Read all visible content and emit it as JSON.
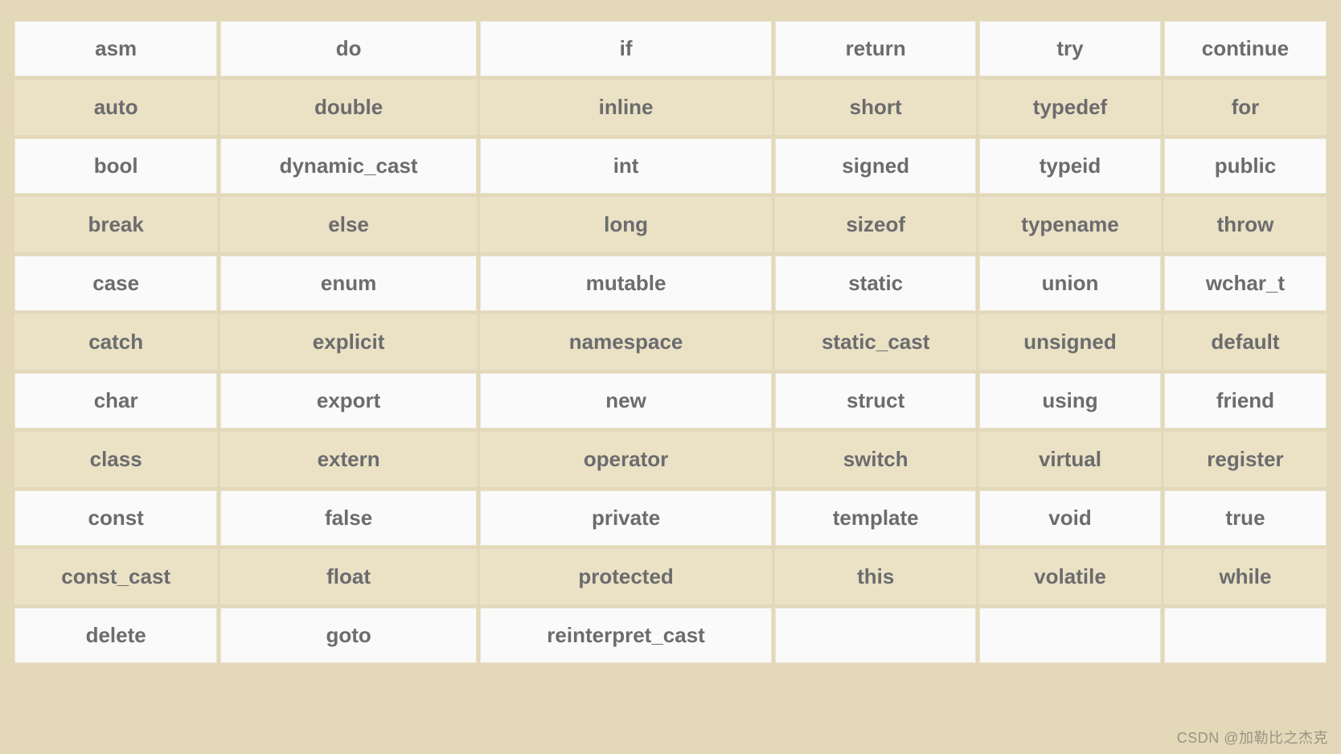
{
  "table": {
    "rows": [
      [
        "asm",
        "do",
        "if",
        "return",
        "try",
        "continue"
      ],
      [
        "auto",
        "double",
        "inline",
        "short",
        "typedef",
        "for"
      ],
      [
        "bool",
        "dynamic_cast",
        "int",
        "signed",
        "typeid",
        "public"
      ],
      [
        "break",
        "else",
        "long",
        "sizeof",
        "typename",
        "throw"
      ],
      [
        "case",
        "enum",
        "mutable",
        "static",
        "union",
        "wchar_t"
      ],
      [
        "catch",
        "explicit",
        "namespace",
        "static_cast",
        "unsigned",
        "default"
      ],
      [
        "char",
        "export",
        "new",
        "struct",
        "using",
        "friend"
      ],
      [
        "class",
        "extern",
        "operator",
        "switch",
        "virtual",
        "register"
      ],
      [
        "const",
        "false",
        "private",
        "template",
        "void",
        "true"
      ],
      [
        "const_cast",
        "float",
        "protected",
        "this",
        "volatile",
        "while"
      ],
      [
        "delete",
        "goto",
        "reinterpret_cast",
        "",
        "",
        ""
      ]
    ]
  },
  "watermark": "CSDN @加勒比之杰克"
}
